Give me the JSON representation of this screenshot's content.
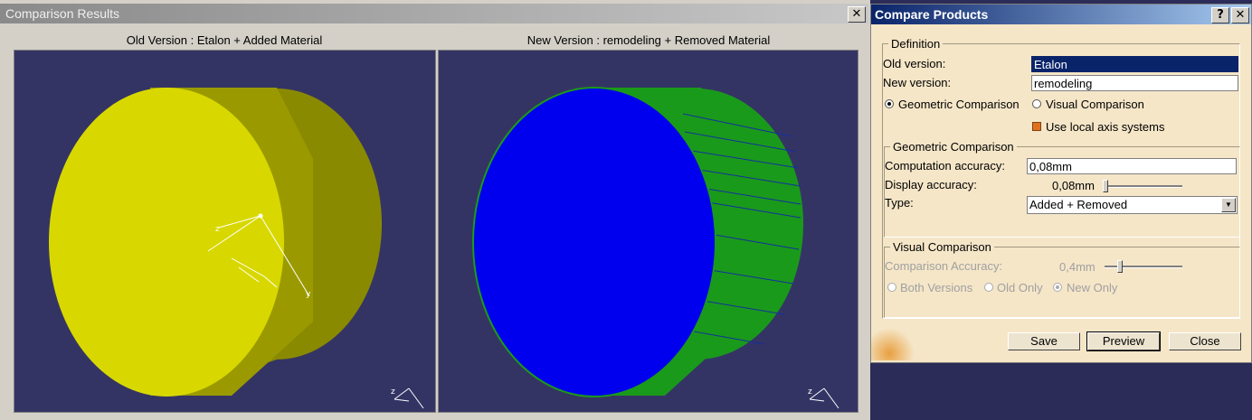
{
  "results_window": {
    "title": "Comparison Results",
    "close_label": "✕",
    "old_viewport_label": "Old Version : Etalon + Added Material",
    "new_viewport_label": "New Version : remodeling + Removed Material",
    "axis_z_label": "z",
    "axis_y_label": "y",
    "colors": {
      "viewport_bg": "#343464",
      "added": "#d8d800",
      "removed": "#0000ee",
      "common": "#1a9a1a"
    }
  },
  "dialog": {
    "title": "Compare Products",
    "help_label": "?",
    "close_label": "✕",
    "definition": {
      "legend": "Definition",
      "old_version_label": "Old version:",
      "old_version_value": "Etalon",
      "new_version_label": "New version:",
      "new_version_value": "remodeling",
      "geometric_option": "Geometric Comparison",
      "visual_option": "Visual Comparison",
      "selected_option": "Geometric Comparison",
      "local_axis_label": "Use local axis systems"
    },
    "geometric": {
      "legend": "Geometric Comparison",
      "computation_label": "Computation accuracy:",
      "computation_value": "0,08mm",
      "display_label": "Display accuracy:",
      "display_value": "0,08mm",
      "type_label": "Type:",
      "type_value": "Added + Removed"
    },
    "visual": {
      "legend": "Visual Comparison",
      "accuracy_label": "Comparison Accuracy:",
      "accuracy_value": "0,4mm",
      "both_label": "Both Versions",
      "old_label": "Old Only",
      "new_label": "New Only",
      "selected": "New Only"
    },
    "buttons": {
      "save": "Save",
      "preview": "Preview",
      "close": "Close"
    }
  }
}
